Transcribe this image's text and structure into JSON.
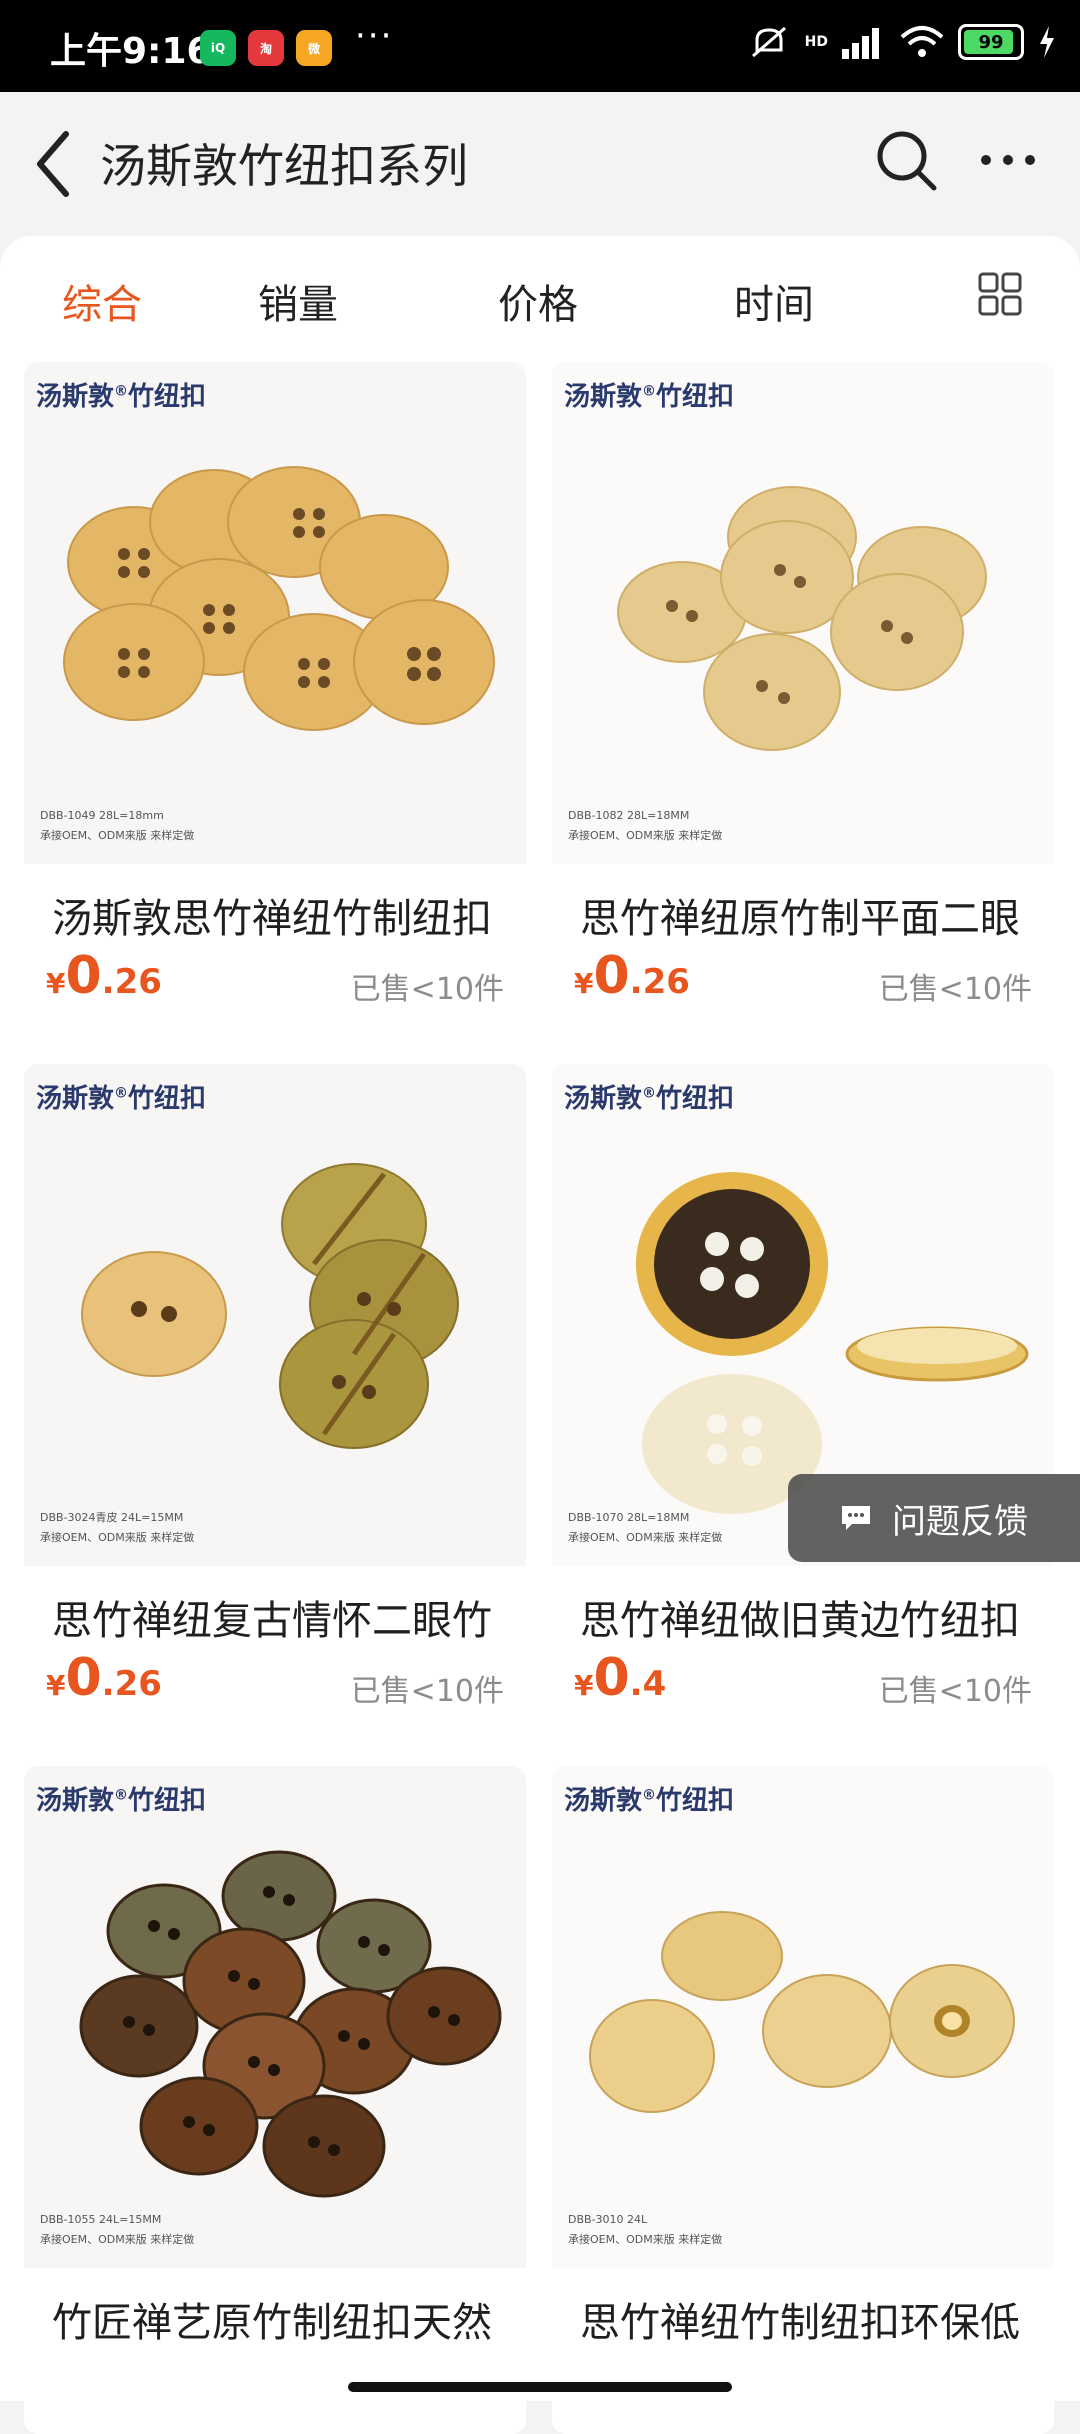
{
  "status_bar": {
    "time": "上午9:16",
    "apps": [
      "iQIYI",
      "淘",
      "微博"
    ],
    "more": "···",
    "network": "HD",
    "battery": "99"
  },
  "header": {
    "title": "汤斯敦竹纽扣系列",
    "back_icon": "chevron-left-icon",
    "search_icon": "search-icon",
    "more_icon": "more-dots-icon"
  },
  "tabs": [
    {
      "label": "综合",
      "active": true
    },
    {
      "label": "销量",
      "active": false
    },
    {
      "label": "价格",
      "active": false
    },
    {
      "label": "时间",
      "active": false
    }
  ],
  "products": [
    {
      "brand": "汤斯敦",
      "brand_suffix": "竹纽扣",
      "caption1": "DBB-1049   28L=18mm",
      "caption2": "承接OEM、ODM来版  来样定做",
      "name": "汤斯敦思竹禅纽竹制纽扣",
      "price_int": "0",
      "price_dec": ".26",
      "sold": "已售<10件"
    },
    {
      "brand": "汤斯敦",
      "brand_suffix": "竹纽扣",
      "caption1": "DBB-1082   28L=18MM",
      "caption2": "承接OEM、ODM来版  来样定做",
      "name": "思竹禅纽原竹制平面二眼",
      "price_int": "0",
      "price_dec": ".26",
      "sold": "已售<10件"
    },
    {
      "brand": "汤斯敦",
      "brand_suffix": "竹纽扣",
      "caption1": "DBB-3024青皮   24L=15MM",
      "caption2": "承接OEM、ODM来版  来样定做",
      "name": "思竹禅纽复古情怀二眼竹",
      "price_int": "0",
      "price_dec": ".26",
      "sold": "已售<10件"
    },
    {
      "brand": "汤斯敦",
      "brand_suffix": "竹纽扣",
      "caption1": "DBB-1070   28L=18MM",
      "caption2": "承接OEM、ODM来版  来样定做",
      "name": "思竹禅纽做旧黄边竹纽扣",
      "price_int": "0",
      "price_dec": ".4",
      "sold": "已售<10件"
    },
    {
      "brand": "汤斯敦",
      "brand_suffix": "竹纽扣",
      "caption1": "DBB-1055   24L=15MM",
      "caption2": "承接OEM、ODM来版  来样定做",
      "name": "竹匠禅艺原竹制纽扣天然",
      "price_int": "",
      "price_dec": "",
      "sold": ""
    },
    {
      "brand": "汤斯敦",
      "brand_suffix": "竹纽扣",
      "caption1": "DBB-3010   24L",
      "caption2": "承接OEM、ODM来版  来样定做",
      "name": "思竹禅纽竹制纽扣环保低",
      "price_int": "",
      "price_dec": "",
      "sold": ""
    }
  ],
  "currency": "¥",
  "feedback": {
    "label": "问题反馈",
    "icon": "chat-bubble-icon"
  },
  "colors": {
    "accent": "#e8561f",
    "brand_text": "#2b3a6d"
  }
}
